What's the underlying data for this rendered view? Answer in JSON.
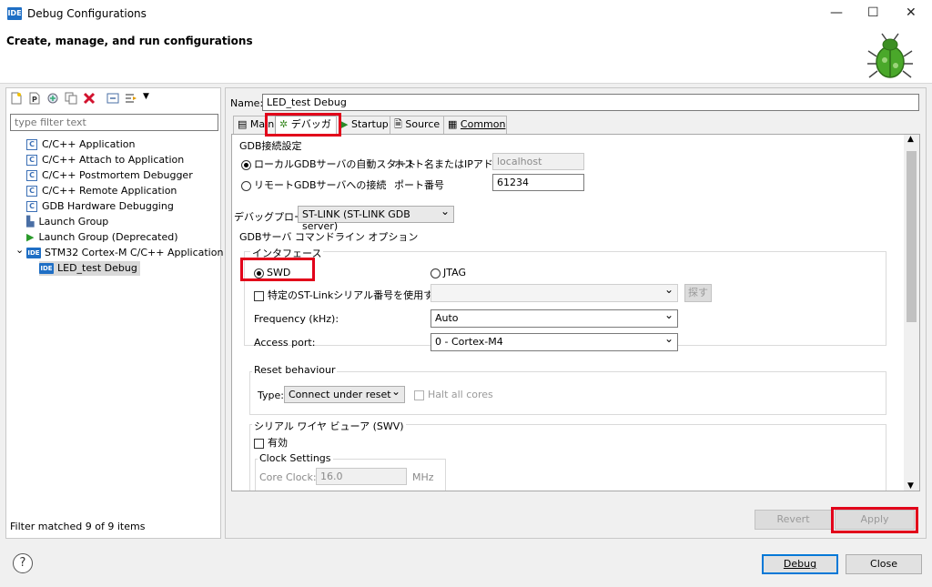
{
  "window": {
    "title": "Debug Configurations",
    "icon_text": "IDE",
    "minimize": "—",
    "maximize": "☐",
    "close": "✕"
  },
  "banner": {
    "title": "Create, manage, and run configurations"
  },
  "left": {
    "filter_placeholder": "type filter text",
    "tree": [
      {
        "label": "C/C++ Application",
        "icon": "c-config-icon"
      },
      {
        "label": "C/C++ Attach to Application",
        "icon": "c-config-icon"
      },
      {
        "label": "C/C++ Postmortem Debugger",
        "icon": "c-config-icon"
      },
      {
        "label": "C/C++ Remote Application",
        "icon": "c-config-icon"
      },
      {
        "label": "GDB Hardware Debugging",
        "icon": "c-config-icon"
      },
      {
        "label": "Launch Group",
        "icon": "launch-group-icon"
      },
      {
        "label": "Launch Group (Deprecated)",
        "icon": "green-play-icon"
      },
      {
        "label": "STM32 Cortex-M C/C++ Application",
        "icon": "ide-icon",
        "expanded": true
      },
      {
        "label": "LED_test Debug",
        "icon": "ide-icon",
        "selected": true
      }
    ],
    "status": "Filter matched 9 of 9 items"
  },
  "right": {
    "name_label": "Name:",
    "name_value": "LED_test Debug",
    "tabs": [
      "Main",
      "デバッガ",
      "Startup",
      "Source",
      "Common"
    ],
    "gdb": {
      "group_label": "GDB接続設定",
      "local_label": "ローカルGDBサーバの自動スタート",
      "remote_label": "リモートGDBサーバへの接続",
      "host_label": "ホスト名またはIPアドレス",
      "host_value": "localhost",
      "port_label": "ポート番号",
      "port_value": "61234"
    },
    "probe_label": "デバッグプローブ",
    "probe_value": "ST-LINK (ST-LINK GDB server)",
    "server": {
      "group_label": "GDBサーバ コマンドライン オプション",
      "interface_label": "インタフェース",
      "swd_label": "SWD",
      "jtag_label": "JTAG",
      "stlink_serial_label": "特定のST-Linkシリアル番号を使用する",
      "search_button": "探す",
      "freq_label": "Frequency (kHz):",
      "freq_value": "Auto",
      "access_label": "Access port:",
      "access_value": "0 - Cortex-M4"
    },
    "reset": {
      "group_label": "Reset behaviour",
      "type_label": "Type:",
      "type_value": "Connect under reset",
      "halt_label": "Halt all cores"
    },
    "swv": {
      "group_label": "シリアル ワイヤ ビューア (SWV)",
      "enable_label": "有効",
      "clock_label": "Clock Settings",
      "core_clock_label": "Core Clock:",
      "core_clock_value": "16.0",
      "core_clock_unit": "MHz"
    },
    "revert": "Revert",
    "apply": "Apply"
  },
  "footer": {
    "help": "?",
    "debug": "Debug",
    "close": "Close"
  },
  "colors": {
    "highlight": "#e2001a",
    "accent": "#0078d7"
  }
}
